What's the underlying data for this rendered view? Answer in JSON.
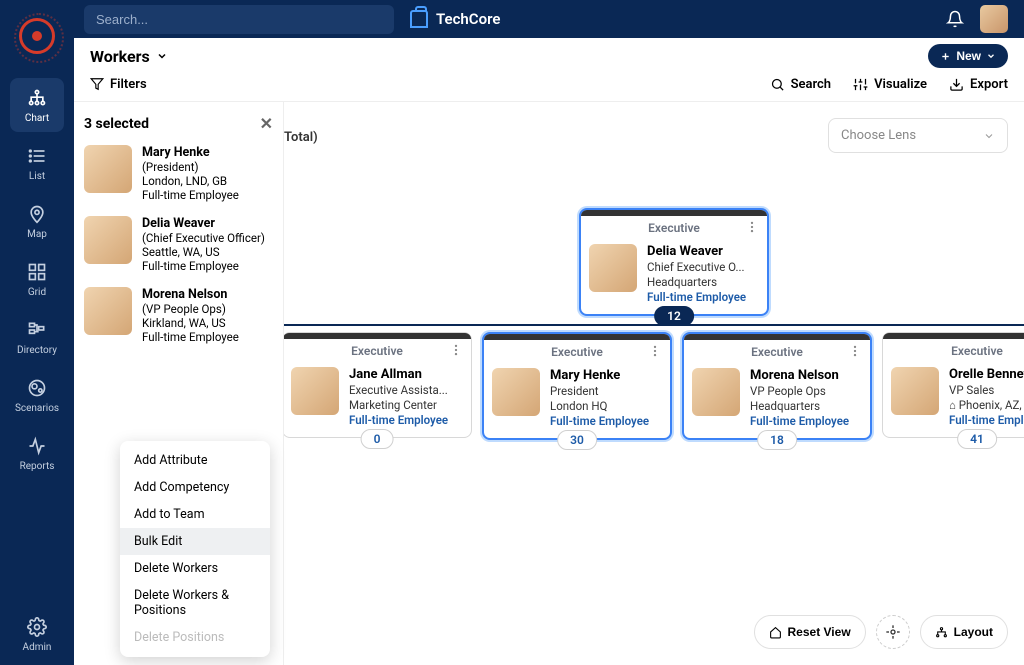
{
  "app": {
    "brand": "TechCore",
    "search_placeholder": "Search..."
  },
  "nav": {
    "items": [
      {
        "label": "Chart",
        "name": "nav-chart"
      },
      {
        "label": "List",
        "name": "nav-list"
      },
      {
        "label": "Map",
        "name": "nav-map"
      },
      {
        "label": "Grid",
        "name": "nav-grid"
      },
      {
        "label": "Directory",
        "name": "nav-directory"
      },
      {
        "label": "Scenarios",
        "name": "nav-scenarios"
      },
      {
        "label": "Reports",
        "name": "nav-reports"
      }
    ],
    "admin": {
      "label": "Admin"
    }
  },
  "header": {
    "title": "Workers",
    "new_label": "New",
    "filters_label": "Filters",
    "search_label": "Search",
    "visualize_label": "Visualize",
    "export_label": "Export"
  },
  "canvas": {
    "total_label": "Total)",
    "lens_placeholder": "Choose Lens",
    "reset_label": "Reset View",
    "layout_label": "Layout"
  },
  "org": {
    "anchor": {
      "dept": "Executive",
      "name": "Delia Weaver",
      "role": "Chief Executive O...",
      "loc": "Headquarters",
      "type": "Full-time Employee",
      "count": "12"
    },
    "children": [
      {
        "dept": "Executive",
        "name": "Jane Allman",
        "role": "Executive Assista...",
        "loc": "Marketing Center",
        "type": "Full-time Employee",
        "count": "0",
        "selected": false
      },
      {
        "dept": "Executive",
        "name": "Mary Henke",
        "role": "President",
        "loc": "London HQ",
        "type": "Full-time Employee",
        "count": "30",
        "selected": true
      },
      {
        "dept": "Executive",
        "name": "Morena Nelson",
        "role": "VP People Ops",
        "loc": "Headquarters",
        "type": "Full-time Employee",
        "count": "18",
        "selected": true
      },
      {
        "dept": "Executive",
        "name": "Orelle Bennett",
        "role": "VP Sales",
        "loc": "⌂ Phoenix, AZ, U",
        "type": "Full-time Empl",
        "count": "41",
        "selected": false
      }
    ]
  },
  "selection": {
    "header": "3 selected",
    "items": [
      {
        "name": "Mary Henke",
        "role": "(President)",
        "loc": "London, LND, GB",
        "type": "Full-time Employee"
      },
      {
        "name": "Delia Weaver",
        "role": "(Chief Executive Officer)",
        "loc": "Seattle, WA, US",
        "type": "Full-time Employee"
      },
      {
        "name": "Morena Nelson",
        "role": "(VP People Ops)",
        "loc": "Kirkland, WA, US",
        "type": "Full-time Employee"
      }
    ]
  },
  "context_menu": {
    "items": [
      {
        "label": "Add Attribute",
        "disabled": false
      },
      {
        "label": "Add Competency",
        "disabled": false
      },
      {
        "label": "Add to Team",
        "disabled": false
      },
      {
        "label": "Bulk Edit",
        "disabled": false,
        "hl": true
      },
      {
        "label": "Delete Workers",
        "disabled": false
      },
      {
        "label": "Delete Workers & Positions",
        "disabled": false
      },
      {
        "label": "Delete Positions",
        "disabled": true
      }
    ]
  }
}
